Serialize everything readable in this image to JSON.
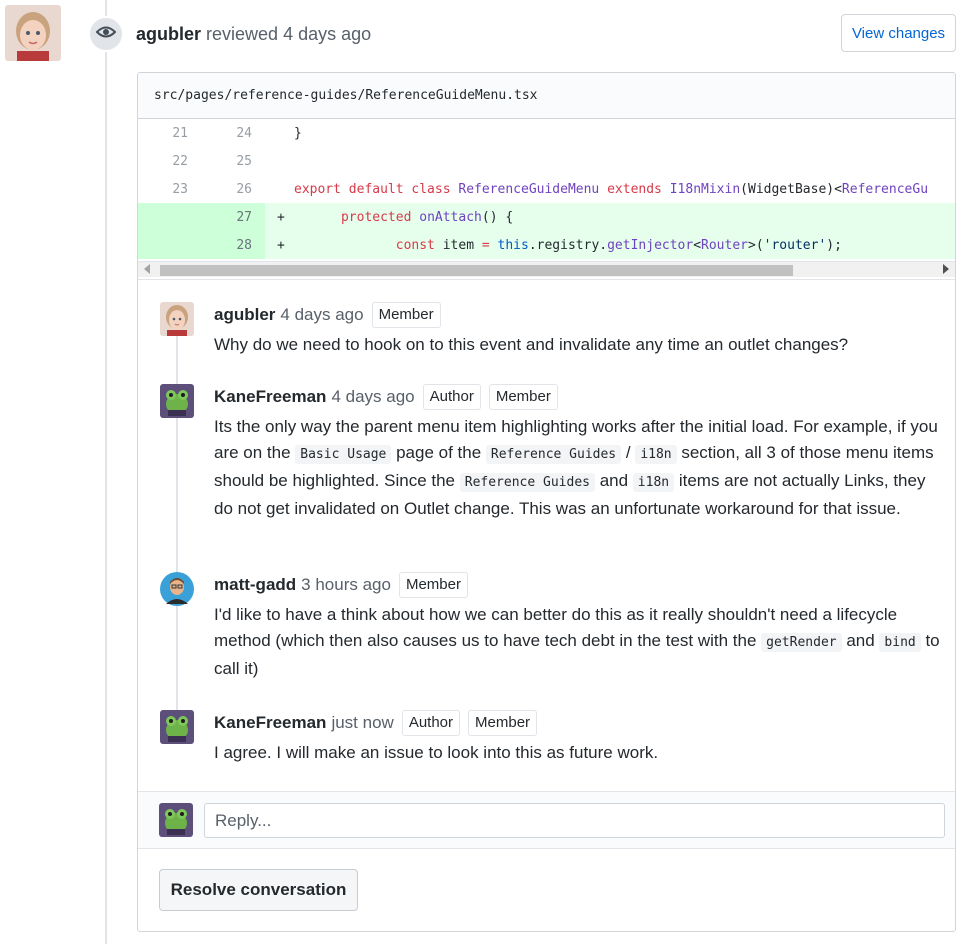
{
  "review": {
    "author": "agubler",
    "action": "reviewed",
    "time": "4 days ago",
    "view_changes_label": "View changes"
  },
  "file": {
    "path": "src/pages/reference-guides/ReferenceGuideMenu.tsx"
  },
  "diff": [
    {
      "old": "21",
      "new": "24",
      "marker": "",
      "type": "context",
      "tokens": [
        {
          "t": "}",
          "c": ""
        }
      ]
    },
    {
      "old": "22",
      "new": "25",
      "marker": "",
      "type": "context",
      "tokens": []
    },
    {
      "old": "23",
      "new": "26",
      "marker": "",
      "type": "context",
      "tokens": [
        {
          "t": "export default class ",
          "c": "kw"
        },
        {
          "t": "ReferenceGuideMenu",
          "c": "fn"
        },
        {
          "t": " extends ",
          "c": "kw"
        },
        {
          "t": "I18nMixin",
          "c": "fn"
        },
        {
          "t": "(WidgetBase)<",
          "c": ""
        },
        {
          "t": "ReferenceGu",
          "c": "fn"
        }
      ]
    },
    {
      "old": "",
      "new": "27",
      "marker": "+",
      "type": "added",
      "tokens": [
        {
          "t": "      ",
          "c": ""
        },
        {
          "t": "protected ",
          "c": "kw"
        },
        {
          "t": "onAttach",
          "c": "fn"
        },
        {
          "t": "() {",
          "c": ""
        }
      ]
    },
    {
      "old": "",
      "new": "28",
      "marker": "+",
      "type": "added",
      "tokens": [
        {
          "t": "             ",
          "c": ""
        },
        {
          "t": "const ",
          "c": "kw"
        },
        {
          "t": "item ",
          "c": ""
        },
        {
          "t": "= ",
          "c": "kw"
        },
        {
          "t": "this",
          "c": "cn"
        },
        {
          "t": ".registry.",
          "c": ""
        },
        {
          "t": "getInjector",
          "c": "fn"
        },
        {
          "t": "<",
          "c": ""
        },
        {
          "t": "Router",
          "c": "fn"
        },
        {
          "t": ">(",
          "c": ""
        },
        {
          "t": "'router'",
          "c": "str"
        },
        {
          "t": ");",
          "c": ""
        }
      ]
    }
  ],
  "comments": [
    {
      "author": "agubler",
      "time": "4 days ago",
      "badges": [
        "Member"
      ],
      "avatar": "girl",
      "body": [
        {
          "t": "Why do we need to hook on to this event and invalidate any time an outlet changes?"
        }
      ]
    },
    {
      "author": "KaneFreeman",
      "time": "4 days ago",
      "badges": [
        "Author",
        "Member"
      ],
      "avatar": "frog",
      "body": [
        {
          "t": "Its the only way the parent menu item highlighting works after the initial load. For example, if you are on the "
        },
        {
          "code": "Basic Usage"
        },
        {
          "t": " page of the "
        },
        {
          "code": "Reference Guides"
        },
        {
          "t": " / "
        },
        {
          "code": "i18n"
        },
        {
          "t": " section, all 3 of those menu items should be highlighted. Since the "
        },
        {
          "code": "Reference Guides"
        },
        {
          "t": " and "
        },
        {
          "code": "i18n"
        },
        {
          "t": " items are not actually Links, they do not get invalidated on Outlet change. This was an unfortunate workaround for that issue."
        }
      ]
    },
    {
      "author": "matt-gadd",
      "time": "3 hours ago",
      "badges": [
        "Member"
      ],
      "avatar": "man",
      "body": [
        {
          "t": "I'd like to have a think about how we can better do this as it really shouldn't need a lifecycle method (which then also causes us to have tech debt in the test with the "
        },
        {
          "code": "getRender"
        },
        {
          "t": " and "
        },
        {
          "code": "bind"
        },
        {
          "t": " to call it)"
        }
      ]
    },
    {
      "author": "KaneFreeman",
      "time": "just now",
      "badges": [
        "Author",
        "Member"
      ],
      "avatar": "frog",
      "body": [
        {
          "t": "I agree. I will make an issue to look into this as future work."
        }
      ]
    }
  ],
  "reply": {
    "placeholder": "Reply..."
  },
  "resolve_label": "Resolve conversation",
  "icons": {
    "review": "eye-icon"
  },
  "colors": {
    "link": "#0366d6",
    "added_bg": "#e6ffed",
    "added_gutter": "#cdffd8",
    "keyword": "#d73a49",
    "entity": "#6f42c1"
  }
}
